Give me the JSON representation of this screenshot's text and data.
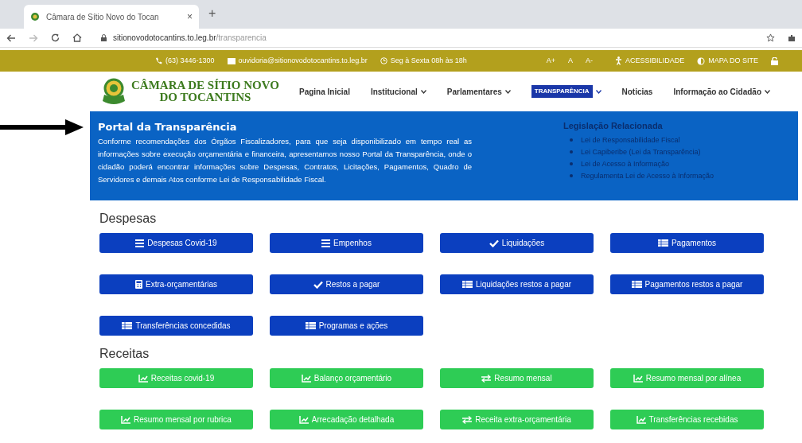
{
  "browser": {
    "tab_title": "Câmara de Sítio Novo do Tocan",
    "tab_close": "×",
    "new_tab": "+",
    "url_host": "sitionovodotocantins.to.leg.br",
    "url_path": "/transparencia"
  },
  "top_bar": {
    "phone": "(63) 3446-1300",
    "email": "ouvidoria@sitionovodotocantins.to.leg.br",
    "hours": "Seg à Sexta 08h às 18h",
    "font_sizes": [
      "A+",
      "A",
      "A-"
    ],
    "accessibility": "ACESSIBILIDADE",
    "sitemap": "MAPA DO SITE"
  },
  "header": {
    "logo_line1": "CÂMARA DE SÍTIO NOVO",
    "logo_line2": "DO TOCANTINS",
    "nav": [
      {
        "label": "Pagina Inicial",
        "dropdown": false,
        "selected": false
      },
      {
        "label": "Institucional",
        "dropdown": true,
        "selected": false
      },
      {
        "label": "Parlamentares",
        "dropdown": true,
        "selected": false
      },
      {
        "label": "TRANSPARÊNCIA",
        "dropdown": true,
        "selected": true
      },
      {
        "label": "Noticias",
        "dropdown": false,
        "selected": false
      },
      {
        "label": "Informação ao Cidadão",
        "dropdown": true,
        "selected": false
      }
    ]
  },
  "banner": {
    "title": "Portal da Transparência",
    "text": "Conforme recomendações dos Órgãos Fiscalizadores, para que seja disponibilizado em tempo real as informações sobre execução orçamentária e financeira, apresentamos nosso Portal da Transparência, onde o cidadão poderá encontrar informações sobre Despesas, Contratos, Licitações, Pagamentos, Quadro de Servidores e demais Atos conforme Lei de Responsabilidade Fiscal.",
    "legislation_title": "Legislação Relacionada",
    "legislation": [
      "Lei de Responsabilidade Fiscal",
      "Lei Capiberibe (Lei da Transparência)",
      "Lei de Acesso à Informação",
      "Regulamenta Lei de Acesso à Informação"
    ]
  },
  "sections": [
    {
      "title": "Despesas",
      "kind": "expense",
      "buttons": [
        {
          "label": "Despesas Covid-19",
          "kind": "list"
        },
        {
          "label": "Empenhos",
          "kind": "list"
        },
        {
          "label": "Liquidações",
          "kind": "check"
        },
        {
          "label": "Pagamentos",
          "kind": "table"
        },
        {
          "label": "Extra-orçamentárias",
          "kind": "calculator"
        },
        {
          "label": "Restos a pagar",
          "kind": "check"
        },
        {
          "label": "Liquidações restos a pagar",
          "kind": "table"
        },
        {
          "label": "Pagamentos restos a pagar",
          "kind": "table"
        },
        {
          "label": "Transferências concedidas",
          "kind": "table"
        },
        {
          "label": "Programas e ações",
          "kind": "table"
        }
      ]
    },
    {
      "title": "Receitas",
      "kind": "revenue",
      "buttons": [
        {
          "label": "Receitas covid-19",
          "kind": "chart"
        },
        {
          "label": "Balanço orçamentário",
          "kind": "chart"
        },
        {
          "label": "Resumo mensal",
          "kind": "exchange"
        },
        {
          "label": "Resumo mensal por alínea",
          "kind": "chart"
        },
        {
          "label": "Resumo mensal por rubrica",
          "kind": "chart"
        },
        {
          "label": "Arrecadação detalhada",
          "kind": "chart"
        },
        {
          "label": "Receita extra-orçamentária",
          "kind": "exchange"
        },
        {
          "label": "Transferências recebidas",
          "kind": "chart"
        }
      ]
    }
  ]
}
